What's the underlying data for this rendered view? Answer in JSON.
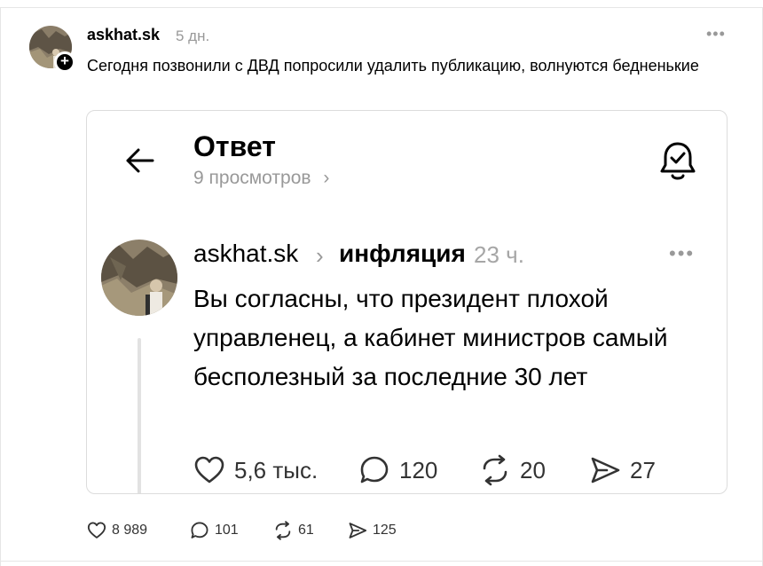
{
  "post": {
    "username": "askhat.sk",
    "time": "5 дн.",
    "more": "•••",
    "add_badge": "+",
    "text": "Сегодня позвонили с ДВД попросили удалить публикацию, волнуются бедненькие"
  },
  "embedded": {
    "title": "Ответ",
    "views": "9 просмотров",
    "views_chevron": "›",
    "username": "askhat.sk",
    "separator": "›",
    "topic": "инфляция",
    "time": "23 ч.",
    "more": "•••",
    "text": "Вы согласны, что президент плохой управленец, а кабинет министров самый бесполезный за последние 30 лет",
    "likes": "5,6 тыс.",
    "comments": "120",
    "reposts": "20",
    "shares": "27"
  },
  "footer": {
    "likes": "8 989",
    "comments": "101",
    "reposts": "61",
    "shares": "125"
  }
}
